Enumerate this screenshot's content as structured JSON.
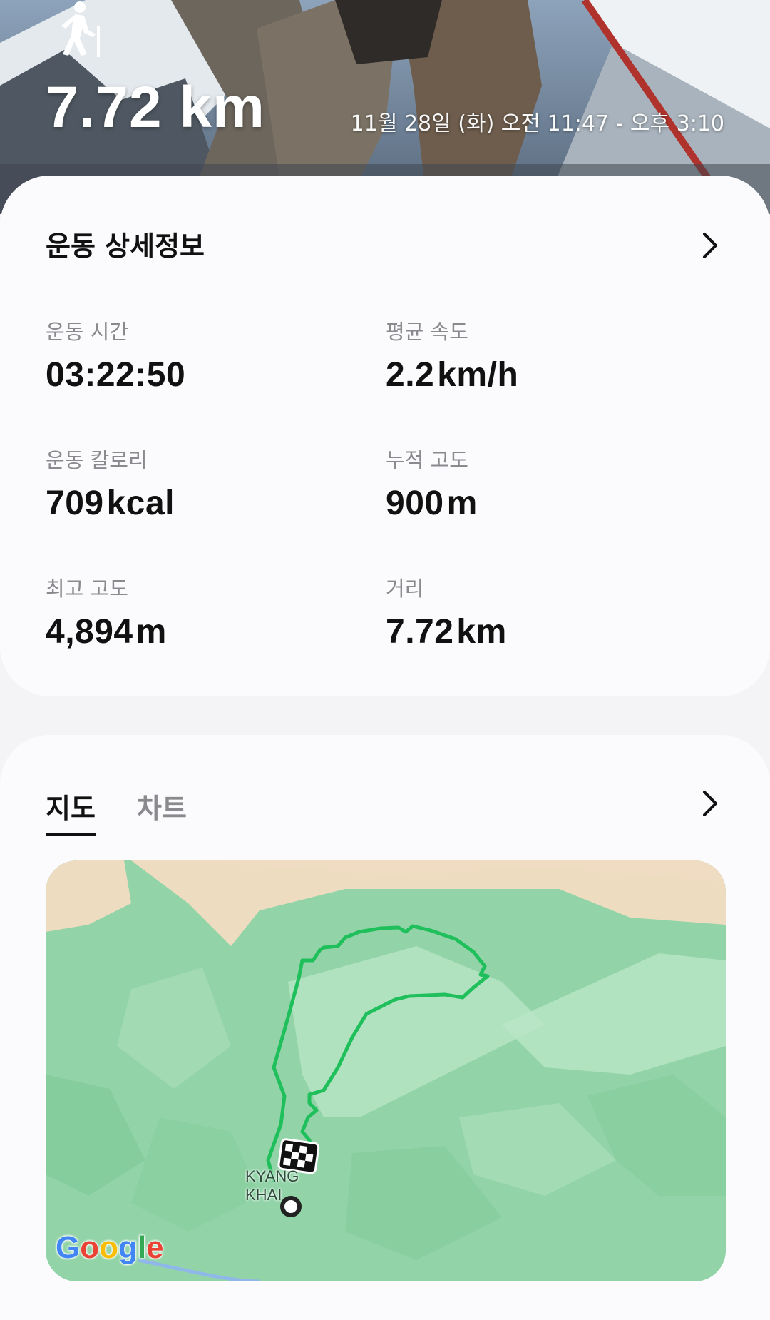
{
  "hero": {
    "distance": "7.72 km",
    "time_range": "11월 28일 (화) 오전 11:47 - 오후 3:10",
    "activity_icon": "hiker-icon"
  },
  "details": {
    "title": "운동 상세정보",
    "stats": [
      {
        "label": "운동 시간",
        "value": "03:22:50",
        "unit": ""
      },
      {
        "label": "평균 속도",
        "value": "2.2",
        "unit": "km/h"
      },
      {
        "label": "운동 칼로리",
        "value": "709",
        "unit": "kcal"
      },
      {
        "label": "누적 고도",
        "value": "900",
        "unit": "m"
      },
      {
        "label": "최고 고도",
        "value": "4,894",
        "unit": "m"
      },
      {
        "label": "거리",
        "value": "7.72",
        "unit": "km"
      }
    ]
  },
  "map_section": {
    "tabs": [
      "지도",
      "차트"
    ],
    "selected_tab": "지도",
    "place_label_line1": "KYANG",
    "place_label_line2": "KHAI",
    "attribution": "Google",
    "route_color": "#1fbf5c"
  }
}
